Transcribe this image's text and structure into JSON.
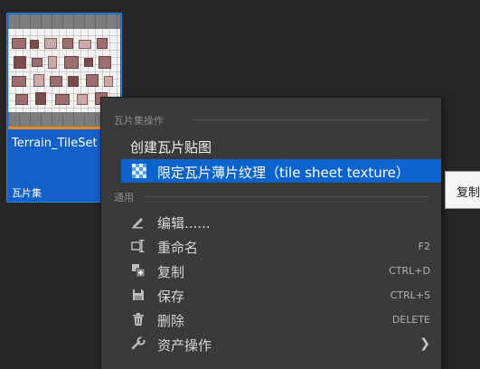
{
  "asset": {
    "name": "Terrain_TileSet",
    "type": "瓦片集"
  },
  "menu": {
    "section_tileset": "瓦片集操作",
    "create_tilemap": "创建瓦片贴图",
    "condition_texture": "限定瓦片薄片纹理（tile sheet texture）",
    "section_common": "通用",
    "items": [
      {
        "label": "编辑......",
        "shortcut": ""
      },
      {
        "label": "重命名",
        "shortcut": "F2"
      },
      {
        "label": "复制",
        "shortcut": "CTRL+D"
      },
      {
        "label": "保存",
        "shortcut": "CTRL+S"
      },
      {
        "label": "删除",
        "shortcut": "DELETE"
      },
      {
        "label": "资产操作",
        "shortcut": ""
      }
    ]
  },
  "submenu": {
    "label": "复制"
  },
  "colors": {
    "selection": "#0d63cc",
    "accent_strip": "#f08a10",
    "menu_bg": "#3a3a3a"
  }
}
